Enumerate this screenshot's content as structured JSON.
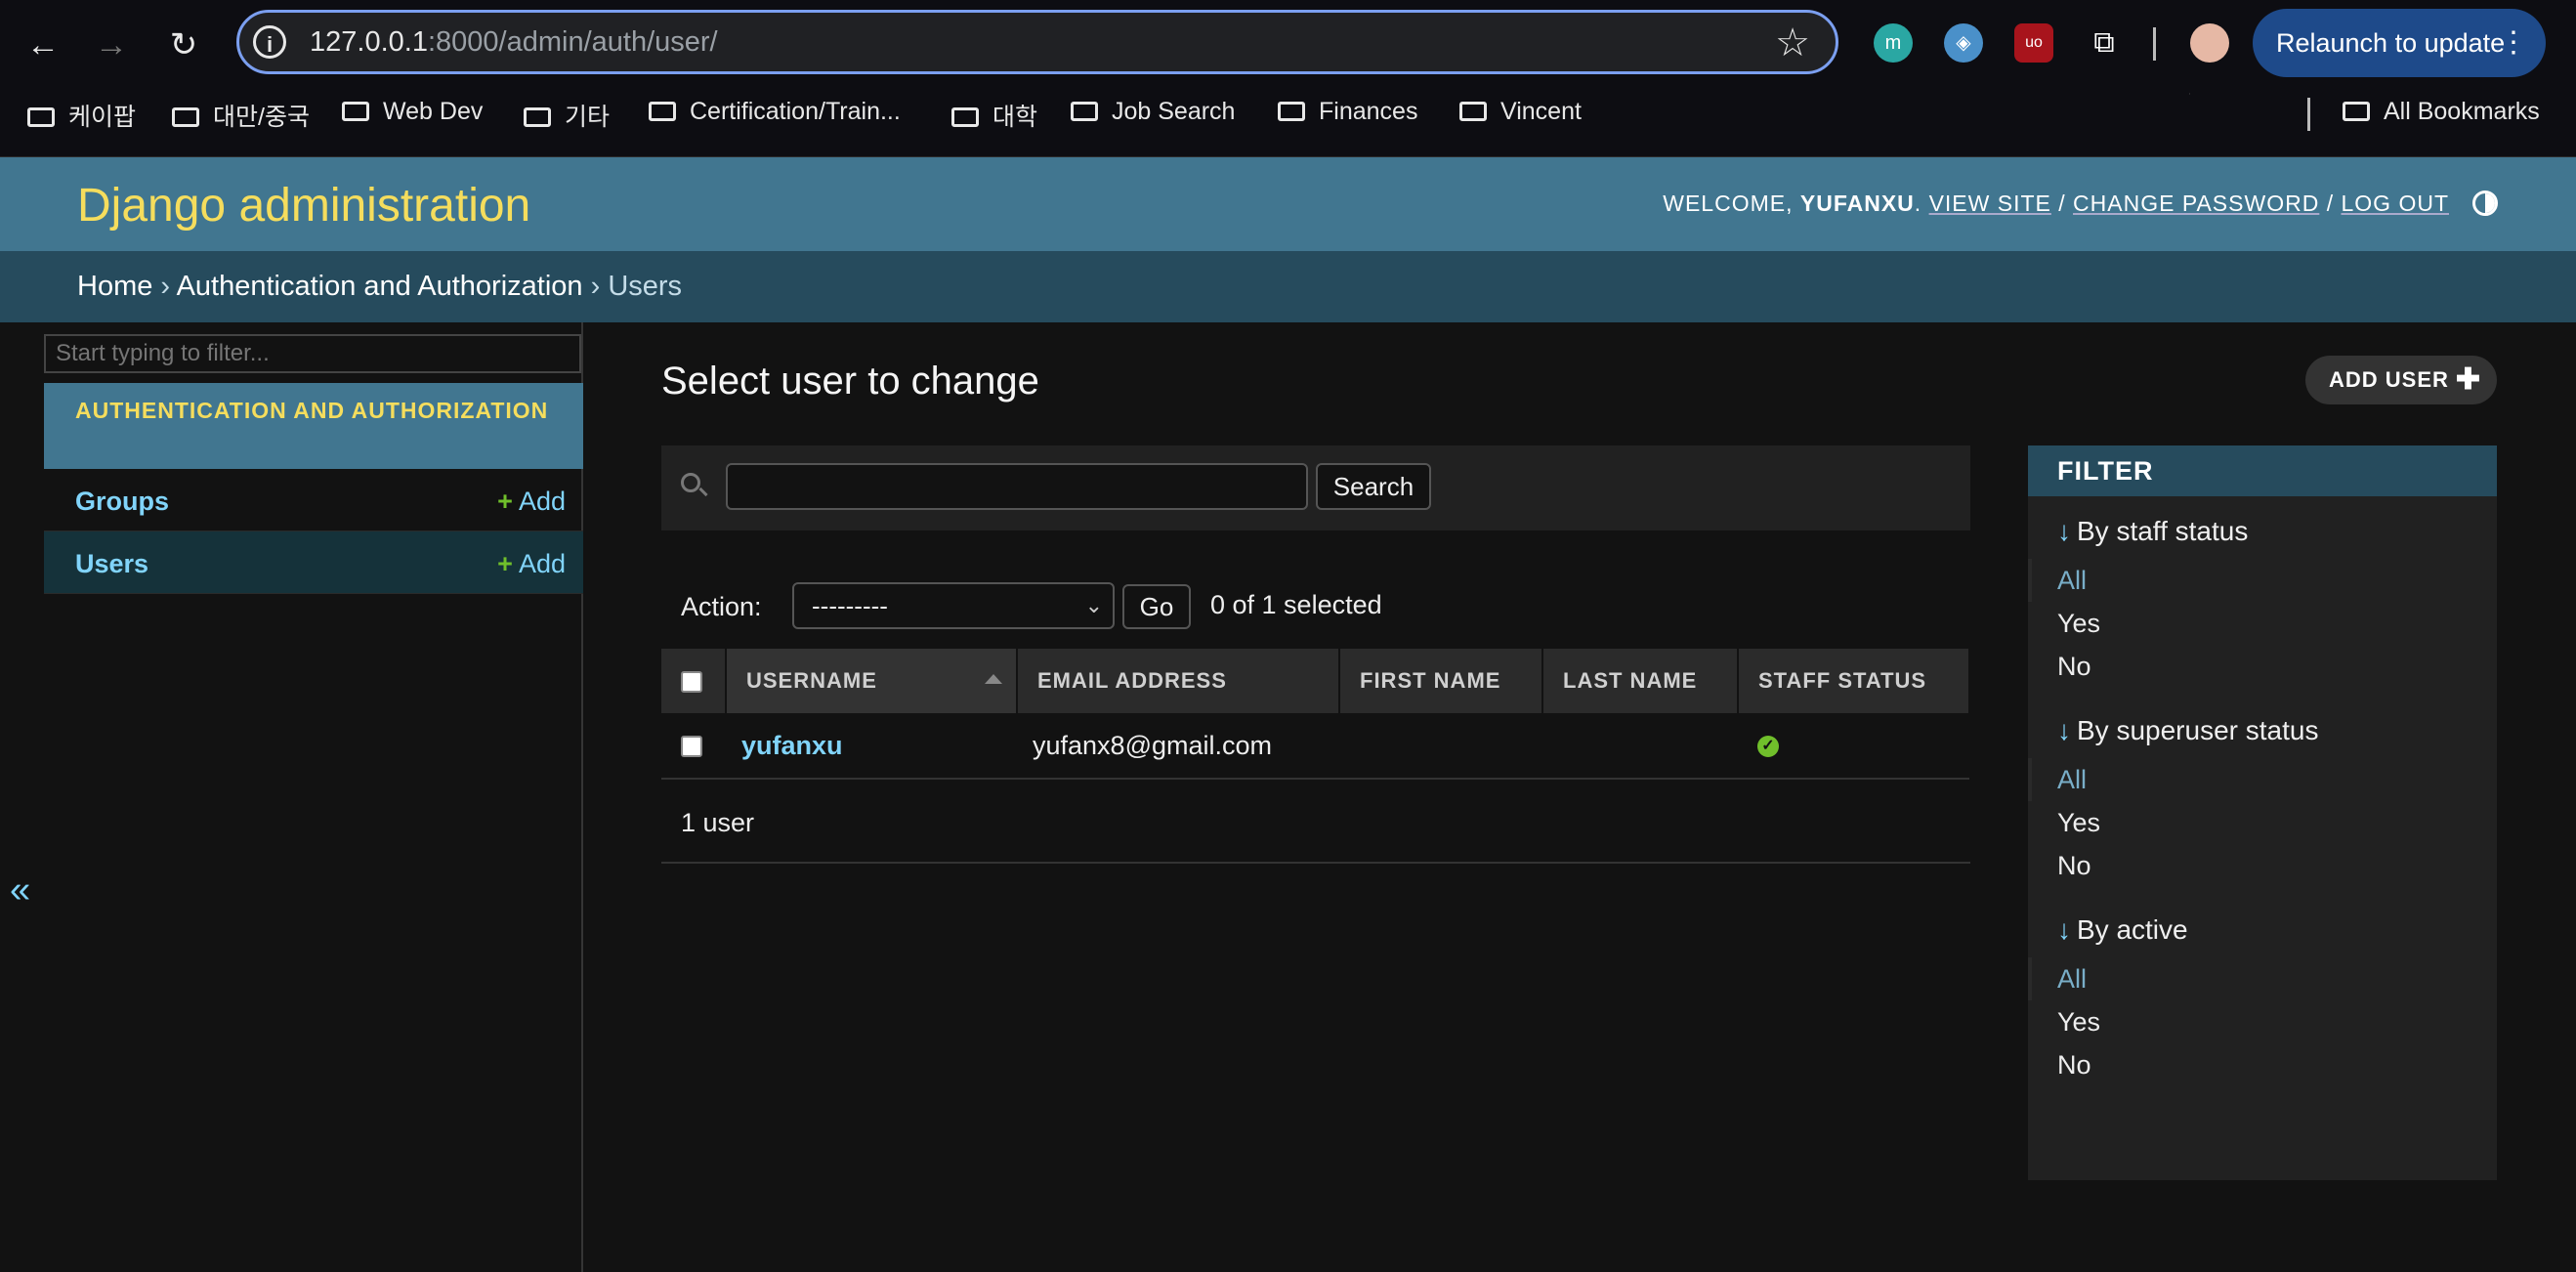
{
  "browser": {
    "url_host": "127.0.0.1",
    "url_rest": ":8000/admin/auth/user/",
    "relaunch_label": "Relaunch to update",
    "bookmarks": [
      "케이팝",
      "대만/중국",
      "Web Dev",
      "기타",
      "Certification/Train...",
      "대학",
      "Job Search",
      "Finances",
      "Vincent"
    ],
    "all_bookmarks": "All Bookmarks",
    "extension_letters": [
      "m",
      "",
      "uo",
      ""
    ]
  },
  "header": {
    "branding": "Django administration",
    "welcome": "Welcome,",
    "username": "yufanxu",
    "view_site": "View site",
    "change_password": "Change password",
    "log_out": "Log out"
  },
  "breadcrumbs": {
    "home": "Home",
    "app": "Authentication and Authorization",
    "current": "Users",
    "separator": "›"
  },
  "sidebar": {
    "filter_placeholder": "Start typing to filter...",
    "app_caption": "Authentication and Authorization",
    "models": [
      {
        "name": "Groups",
        "add": "Add"
      },
      {
        "name": "Users",
        "add": "Add"
      }
    ],
    "collapse_glyph": "«"
  },
  "content": {
    "title": "Select user to change",
    "add_button": "Add user",
    "search_button": "Search",
    "search_value": "",
    "action_label": "Action:",
    "action_selected": "---------",
    "go_button": "Go",
    "action_counter": "0 of 1 selected",
    "columns": [
      "Username",
      "Email address",
      "First name",
      "Last name",
      "Staff status"
    ],
    "rows": [
      {
        "username": "yufanxu",
        "email": "yufanx8@gmail.com",
        "first_name": "",
        "last_name": "",
        "staff_status": true
      }
    ],
    "paginator": "1 user"
  },
  "filter": {
    "title": "Filter",
    "groups": [
      {
        "heading": "By staff status",
        "choices": [
          "All",
          "Yes",
          "No"
        ],
        "selected": "All"
      },
      {
        "heading": "By superuser status",
        "choices": [
          "All",
          "Yes",
          "No"
        ],
        "selected": "All"
      },
      {
        "heading": "By active",
        "choices": [
          "All",
          "Yes",
          "No"
        ],
        "selected": "All"
      }
    ]
  },
  "colors": {
    "header_bg": "#417690",
    "breadcrumbs_bg": "#264b5d",
    "branding": "#f5dd5d",
    "link": "#81d4fa",
    "add_green": "#70bf2b"
  }
}
